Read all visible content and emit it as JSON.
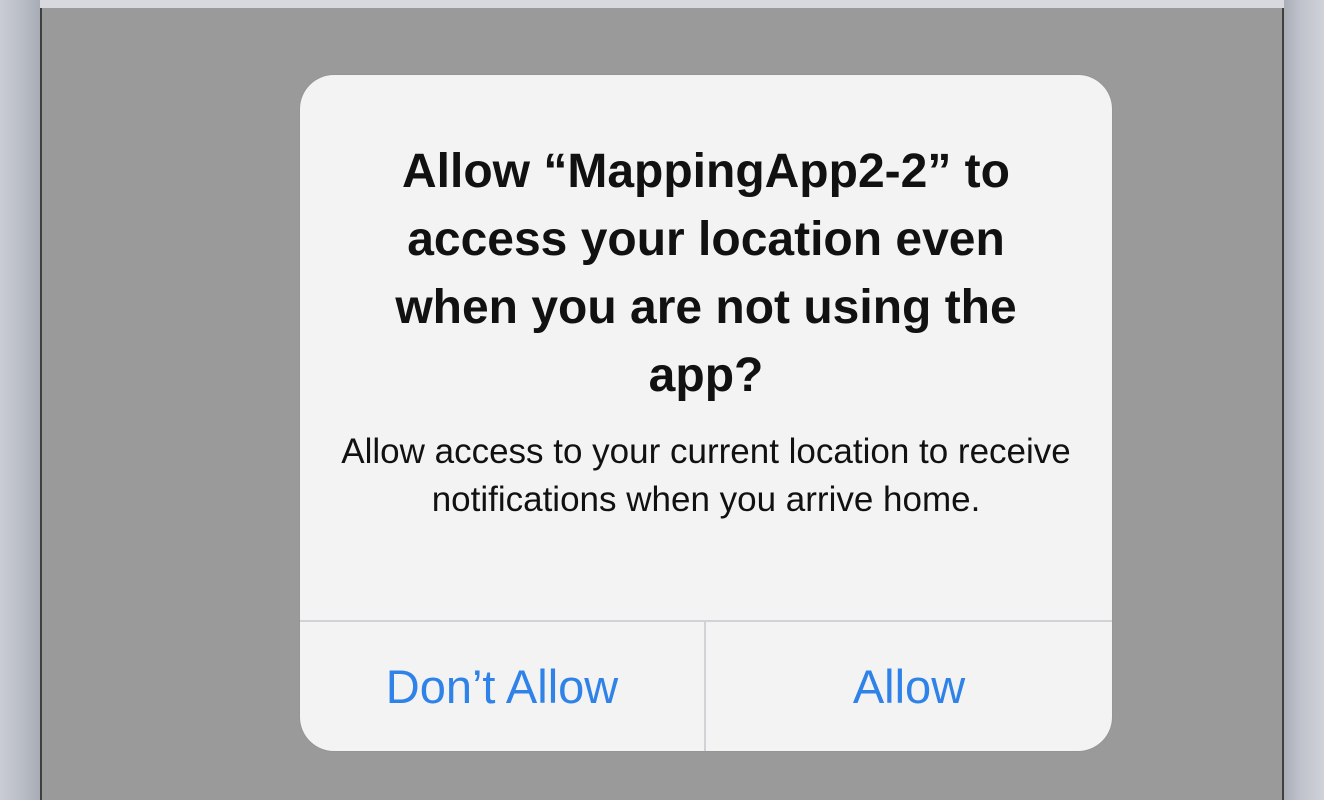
{
  "alert": {
    "title": "Allow “MappingApp2-2” to access your location even when you are not using the app?",
    "message": "Allow access to your current location to receive notifications when you arrive home.",
    "buttons": {
      "deny_label": "Don’t Allow",
      "allow_label": "Allow"
    }
  },
  "colors": {
    "backdrop": "#9a9a9a",
    "alert_background": "#f3f3f3",
    "button_text": "#2e82e8"
  }
}
